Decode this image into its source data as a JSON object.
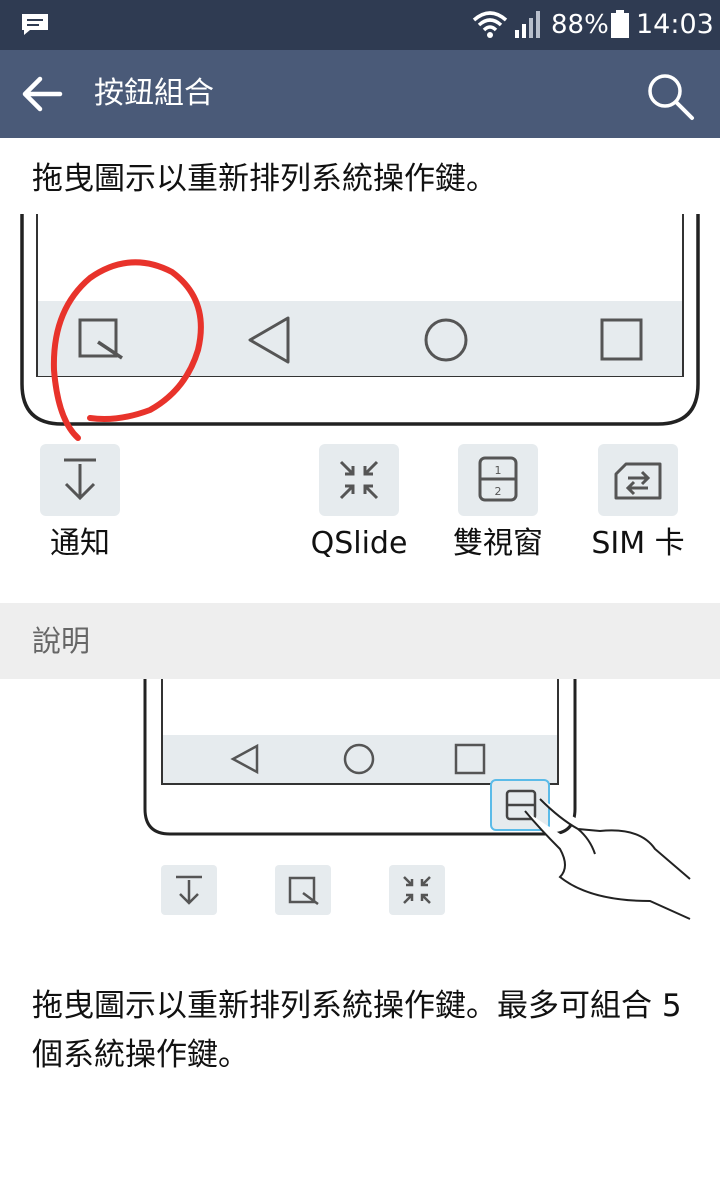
{
  "status_bar": {
    "battery_percent": "88%",
    "time": "14:03",
    "icons": [
      "message-icon",
      "wifi-icon",
      "signal-icon",
      "battery-icon"
    ]
  },
  "app_bar": {
    "title": "按鈕組合",
    "back_icon": "back-arrow-icon",
    "search_icon": "search-icon"
  },
  "intro_text": "拖曳圖示以重新排列系統操作鍵。",
  "nav_bar_keys": [
    "notification-panel-icon",
    "back-triangle-icon",
    "home-circle-icon",
    "recents-square-icon"
  ],
  "available_buttons": [
    {
      "label": "通知",
      "icon": "download-arrow-icon"
    },
    {
      "label": "QSlide",
      "icon": "qslide-icon"
    },
    {
      "label": "雙視窗",
      "icon": "dual-window-icon"
    },
    {
      "label": "SIM 卡",
      "icon": "sim-switch-icon"
    }
  ],
  "section": {
    "title": "說明"
  },
  "description": "拖曳圖示以重新排列系統操作鍵。最多可組合 5 個系統操作鍵。",
  "colors": {
    "status_bar": "#2f3b52",
    "app_bar": "#4a5a78",
    "key_bg": "#e6ebee",
    "annotation": "#e8332b"
  }
}
